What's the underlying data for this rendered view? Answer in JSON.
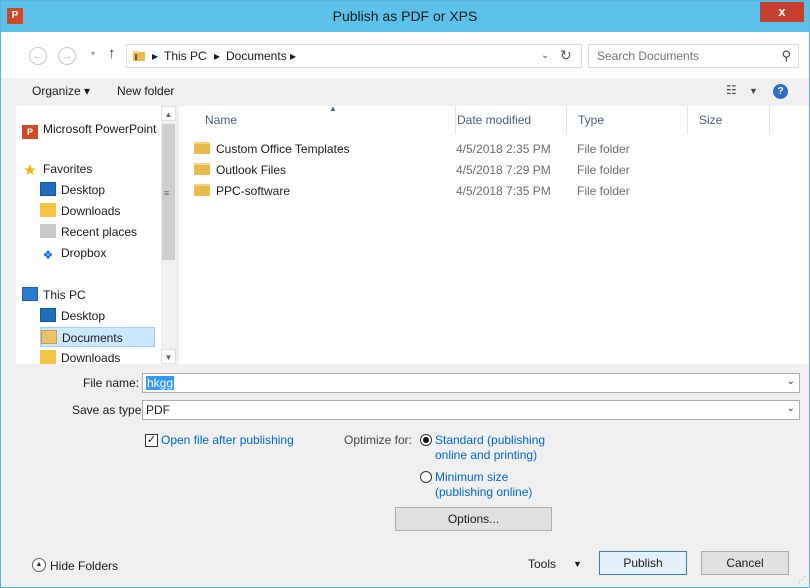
{
  "window": {
    "title": "Publish as PDF or XPS",
    "close_glyph": "x",
    "app_badge": "P"
  },
  "address": {
    "crumbs": [
      "This PC",
      "Documents"
    ],
    "separator": "▸",
    "search_placeholder": "Search Documents"
  },
  "toolbar": {
    "organize_label": "Organize ▾",
    "new_folder_label": "New folder"
  },
  "nav": {
    "app_label": "Microsoft PowerPoint",
    "favorites_label": "Favorites",
    "favorites": [
      "Desktop",
      "Downloads",
      "Recent places",
      "Dropbox"
    ],
    "this_pc_label": "This PC",
    "this_pc_items": [
      "Desktop",
      "Documents",
      "Downloads"
    ],
    "selected": "Documents"
  },
  "columns": {
    "name": "Name",
    "date": "Date modified",
    "type": "Type",
    "size": "Size"
  },
  "files": [
    {
      "name": "Custom Office Templates",
      "date": "4/5/2018 2:35 PM",
      "type": "File folder"
    },
    {
      "name": "Outlook Files",
      "date": "4/5/2018 7:29 PM",
      "type": "File folder"
    },
    {
      "name": "PPC-software",
      "date": "4/5/2018 7:35 PM",
      "type": "File folder"
    }
  ],
  "form": {
    "file_name_label": "File name:",
    "file_name_value": "hkgg",
    "save_type_label": "Save as type:",
    "save_type_value": "PDF",
    "open_after_label": "Open file after publishing",
    "open_after_checked": true,
    "optimize_label": "Optimize for:",
    "opt_standard_l1": "Standard (publishing",
    "opt_standard_l2": "online and printing)",
    "opt_min_l1": "Minimum size",
    "opt_min_l2": "(publishing online)",
    "selected_option": "standard",
    "options_button": "Options..."
  },
  "footer": {
    "hide_folders_label": "Hide Folders",
    "tools_label": "Tools",
    "publish_label": "Publish",
    "cancel_label": "Cancel"
  },
  "colors": {
    "titlebar": "#5cc1e9",
    "close": "#c7402f",
    "link": "#0066cc",
    "selection": "#cce8ff"
  }
}
